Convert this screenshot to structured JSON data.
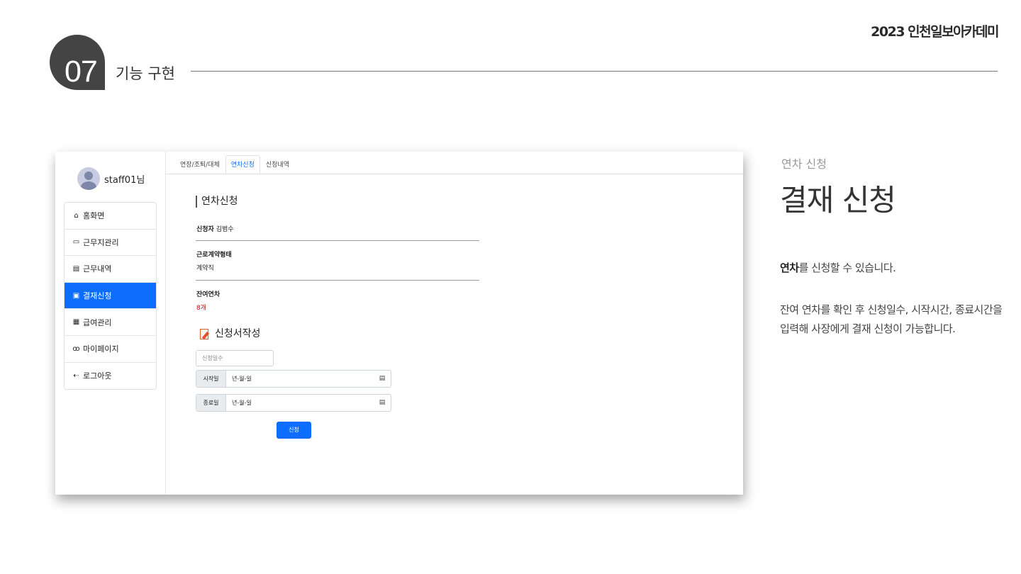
{
  "header": {
    "brand": "2023 인천일보아카데미",
    "section_number": "07",
    "section_title": "기능 구현"
  },
  "app": {
    "username": "staff01님",
    "nav": [
      {
        "icon": "home-icon",
        "glyph": "⌂",
        "label": "홈화면"
      },
      {
        "icon": "briefcase-icon",
        "glyph": "▭",
        "label": "근무지관리"
      },
      {
        "icon": "calendar-clock-icon",
        "glyph": "▤",
        "label": "근무내역"
      },
      {
        "icon": "calendar-icon",
        "glyph": "▣",
        "label": "결재신청",
        "active": true
      },
      {
        "icon": "building-icon",
        "glyph": "▦",
        "label": "급여관리"
      },
      {
        "icon": "people-icon",
        "glyph": "ꝏ",
        "label": "마이페이지"
      },
      {
        "icon": "logout-icon",
        "glyph": "⇠",
        "label": "로그아웃"
      }
    ],
    "tabs": [
      "연장/조퇴/대체",
      "연차신청",
      "신청내역"
    ],
    "active_tab": "연차신청",
    "page_title": "연차신청",
    "applicant_label": "신청자",
    "applicant_value": "김범수",
    "contract_label": "근로계약형태",
    "contract_value": "계약직",
    "remaining_label": "잔여연차",
    "remaining_value": "8개",
    "form_title": "신청서작성",
    "days_placeholder": "신청일수",
    "start_label": "시작일",
    "start_value": "년-월-일",
    "end_label": "종료일",
    "end_value": "년-월-일",
    "submit_label": "신청",
    "accent_color": "#0d6efd",
    "warning_color": "#dd0000"
  },
  "description": {
    "subtitle": "연차 신청",
    "title": "결재 신청",
    "para1_bold": "연차",
    "para1_rest": "를 신청할 수 있습니다.",
    "para2": "잔여 연차를 확인 후 신청일수, 시작시간, 종료시간을 입력해 사장에게 결재 신청이 가능합니다."
  }
}
